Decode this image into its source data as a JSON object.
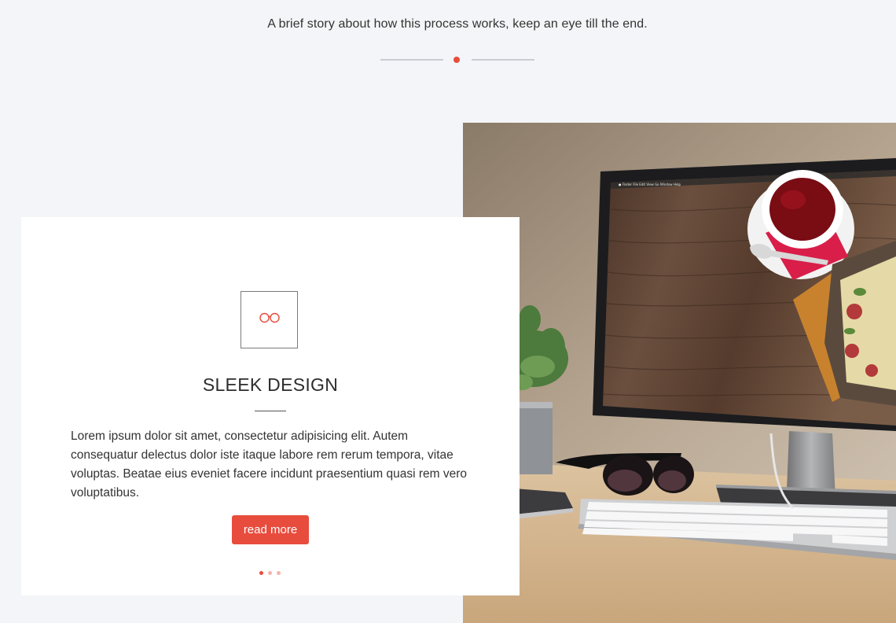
{
  "header": {
    "intro": "A brief story about how this process works, keep an eye till the end."
  },
  "feature": {
    "icon": "glasses-icon",
    "title": "SLEEK DESIGN",
    "text": "Lorem ipsum dolor sit amet, consectetur adipisicing elit. Autem consequatur delectus dolor iste itaque labore rem rerum tempora, vitae voluptas. Beatae eius eveniet facere incidunt praesentium quasi rem vero voluptatibus.",
    "button_label": "read more"
  },
  "pager": {
    "count": 3,
    "active_index": 0
  },
  "photo": {
    "subject": "desk-workspace-with-monitor",
    "menu_bar": "Finder  File  Edit  View  Go  Window  Help"
  },
  "colors": {
    "accent": "#e74c3c",
    "background": "#f4f5f8",
    "card": "#ffffff"
  }
}
